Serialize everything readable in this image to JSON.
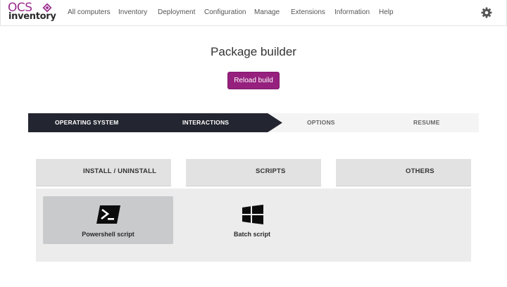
{
  "brand": {
    "line1": "OCS",
    "line2": "inventory",
    "accent": "#9b2c8e"
  },
  "nav": {
    "items": [
      "All computers",
      "Inventory",
      "Deployment",
      "Configuration",
      "Manage",
      "Extensions",
      "Information",
      "Help"
    ],
    "settings_icon": "gear-icon"
  },
  "page": {
    "title": "Package builder"
  },
  "actions": {
    "reload_label": "Reload build",
    "reload_color": "#96207e"
  },
  "wizard": {
    "steps": [
      {
        "label": "OPERATING SYSTEM",
        "state": "done"
      },
      {
        "label": "INTERACTIONS",
        "state": "active"
      },
      {
        "label": "OPTIONS",
        "state": "pending"
      },
      {
        "label": "RESUME",
        "state": "pending"
      }
    ],
    "active_color": "#232530"
  },
  "categories": {
    "tabs": [
      "INSTALL / UNINSTALL",
      "SCRIPTS",
      "OTHERS"
    ]
  },
  "scripts": {
    "items": [
      {
        "label": "Powershell script",
        "icon": "powershell-icon",
        "selected": true
      },
      {
        "label": "Batch script",
        "icon": "windows-icon",
        "selected": false
      }
    ]
  }
}
